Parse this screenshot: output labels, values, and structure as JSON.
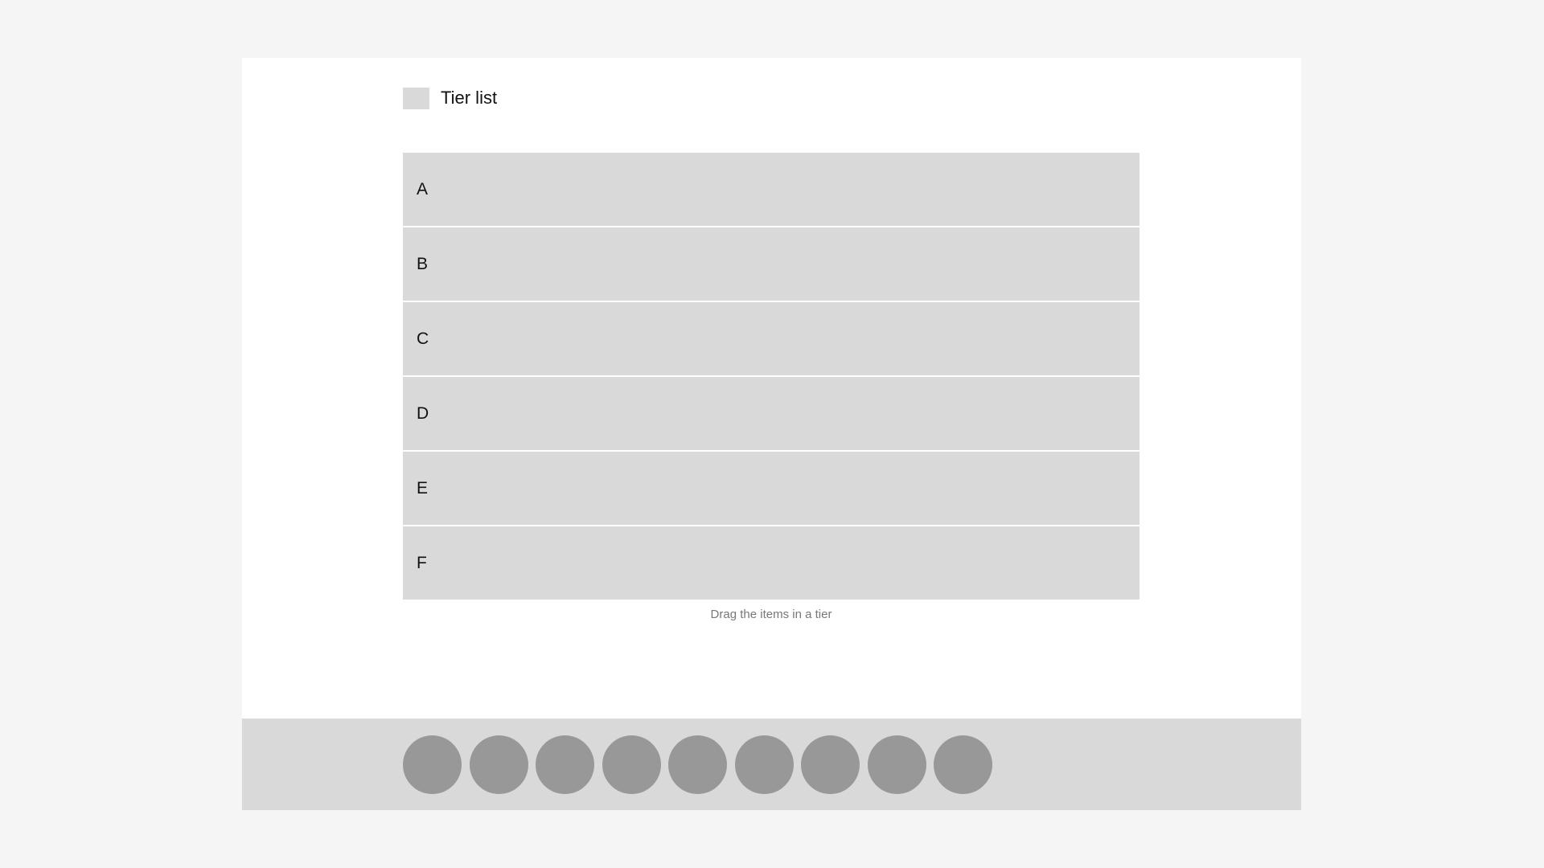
{
  "header": {
    "title": "Tier list"
  },
  "tiers": [
    {
      "label": "A"
    },
    {
      "label": "B"
    },
    {
      "label": "C"
    },
    {
      "label": "D"
    },
    {
      "label": "E"
    },
    {
      "label": "F"
    }
  ],
  "hint": "Drag the items in a tier",
  "tray": {
    "items": [
      {
        "id": "item-1"
      },
      {
        "id": "item-2"
      },
      {
        "id": "item-3"
      },
      {
        "id": "item-4"
      },
      {
        "id": "item-5"
      },
      {
        "id": "item-6"
      },
      {
        "id": "item-7"
      },
      {
        "id": "item-8"
      },
      {
        "id": "item-9"
      }
    ]
  },
  "colors": {
    "background": "#f5f5f5",
    "panel": "#ffffff",
    "tier": "#d9d9d9",
    "item": "#989898",
    "hint": "#777777"
  }
}
